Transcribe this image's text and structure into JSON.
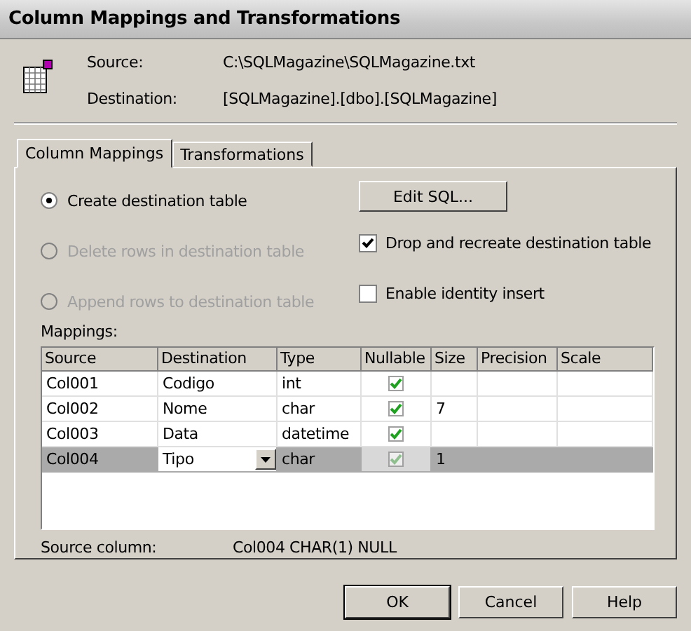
{
  "window": {
    "title": "Column Mappings and Transformations"
  },
  "info": [
    {
      "label": "Source:",
      "value": "C:\\SQLMagazine\\SQLMagazine.txt"
    },
    {
      "label": "Destination:",
      "value": "[SQLMagazine].[dbo].[SQLMagazine]"
    }
  ],
  "tabs": [
    {
      "label": "Column Mappings",
      "selected": true
    },
    {
      "label": "Transformations",
      "selected": false
    }
  ],
  "options": [
    {
      "label": "Create destination table",
      "selected": true,
      "disabled": false
    },
    {
      "label": "Delete rows in destination table",
      "selected": false,
      "disabled": true
    },
    {
      "label": "Append rows to destination table",
      "selected": false,
      "disabled": true
    }
  ],
  "edit_sql_button": "Edit SQL...",
  "checkboxes": [
    {
      "label": "Drop and recreate destination table",
      "checked": true
    },
    {
      "label": "Enable identity insert",
      "checked": false
    }
  ],
  "mappings_label": "Mappings:",
  "table": {
    "columns": [
      "Source",
      "Destination",
      "Type",
      "Nullable",
      "Size",
      "Precision",
      "Scale"
    ],
    "rows": [
      {
        "source": "Col001",
        "destination": "Codigo",
        "type": "int",
        "nullable": true,
        "size": "",
        "selected": false
      },
      {
        "source": "Col002",
        "destination": "Nome",
        "type": "char",
        "nullable": true,
        "size": "7",
        "selected": false
      },
      {
        "source": "Col003",
        "destination": "Data",
        "type": "datetime",
        "nullable": true,
        "size": "",
        "selected": false
      },
      {
        "source": "Col004",
        "destination": "Tipo",
        "type": "char",
        "nullable": true,
        "size": "1",
        "selected": true
      }
    ]
  },
  "source_column": {
    "label": "Source column:",
    "value": "Col004 CHAR(1) NULL"
  },
  "buttons": [
    "OK",
    "Cancel",
    "Help"
  ]
}
